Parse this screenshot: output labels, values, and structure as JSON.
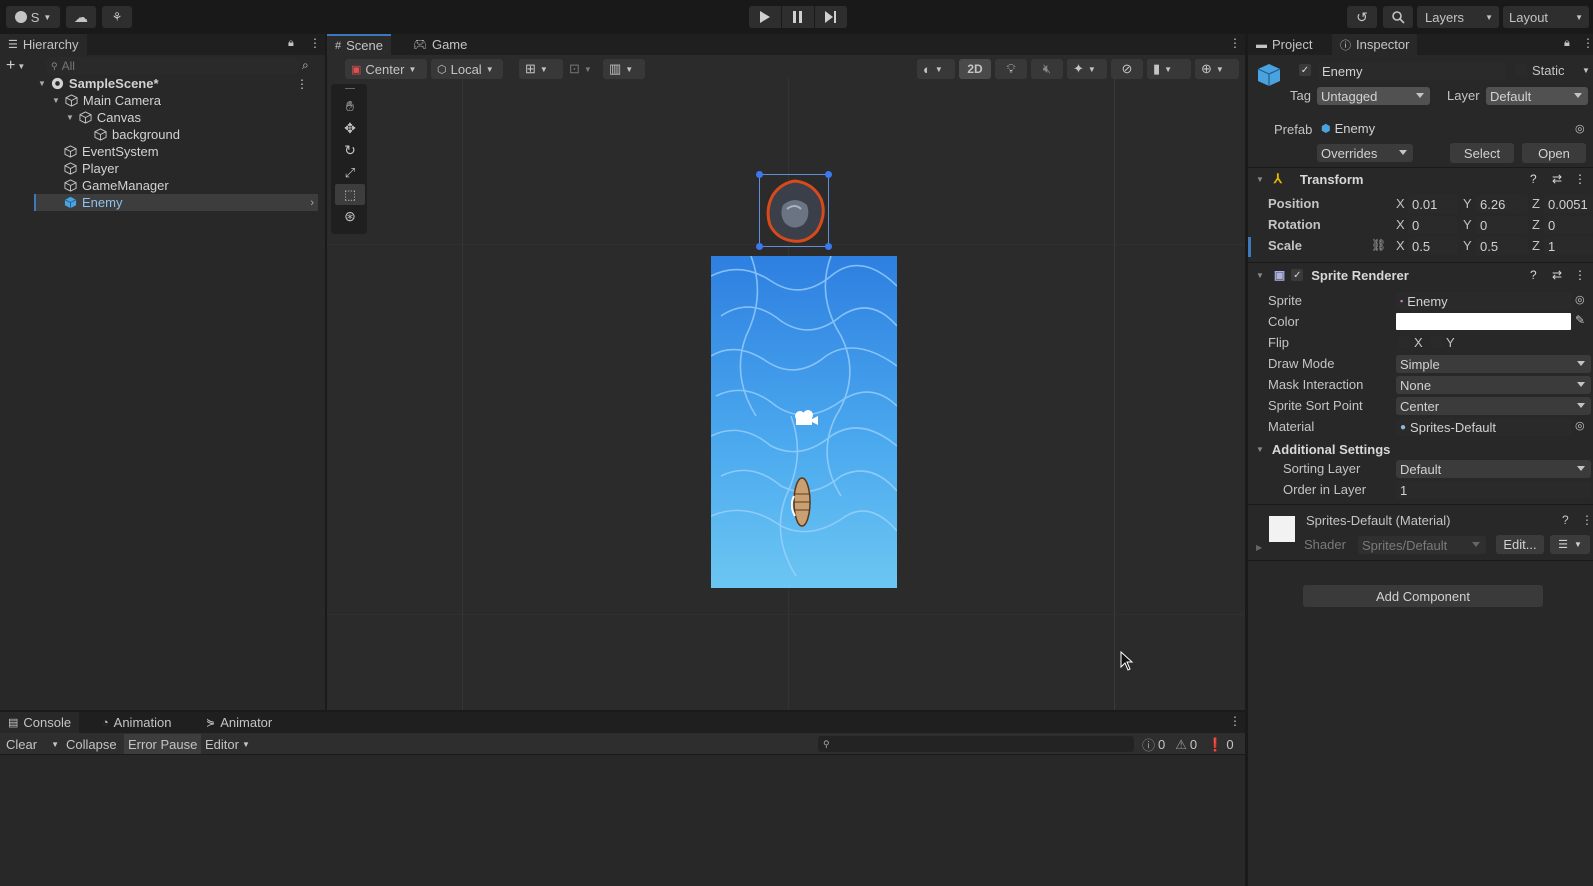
{
  "topbar": {
    "account_label": "S",
    "layers_label": "Layers",
    "layout_label": "Layout"
  },
  "hierarchy": {
    "tab_label": "Hierarchy",
    "search_placeholder": "All",
    "scene_name": "SampleScene*",
    "items": [
      {
        "label": "Main Camera"
      },
      {
        "label": "Canvas"
      },
      {
        "label": "background"
      },
      {
        "label": "EventSystem"
      },
      {
        "label": "Player"
      },
      {
        "label": "GameManager"
      },
      {
        "label": "Enemy"
      }
    ]
  },
  "scene": {
    "tabs": [
      {
        "label": "Scene"
      },
      {
        "label": "Game"
      }
    ],
    "pivot_label": "Center",
    "space_label": "Local",
    "mode_2d_label": "2D"
  },
  "bottom": {
    "tabs": [
      {
        "label": "Console"
      },
      {
        "label": "Animation"
      },
      {
        "label": "Animator"
      }
    ],
    "clear_label": "Clear",
    "collapse_label": "Collapse",
    "error_pause_label": "Error Pause",
    "editor_label": "Editor",
    "log_count": "0",
    "warning_count": "0",
    "error_count": "0"
  },
  "inspector": {
    "tabs": [
      {
        "label": "Project"
      },
      {
        "label": "Inspector"
      }
    ],
    "object_name": "Enemy",
    "static_label": "Static",
    "tag_label": "Tag",
    "tag_value": "Untagged",
    "layer_label": "Layer",
    "layer_value": "Default",
    "prefab_label": "Prefab",
    "prefab_value": "Enemy",
    "overrides_label": "Overrides",
    "select_label": "Select",
    "open_label": "Open",
    "transform": {
      "title": "Transform",
      "position_label": "Position",
      "rotation_label": "Rotation",
      "scale_label": "Scale",
      "position": {
        "x": "0.01",
        "y": "6.26",
        "z": "0.0051"
      },
      "rotation": {
        "x": "0",
        "y": "0",
        "z": "0"
      },
      "scale": {
        "x": "0.5",
        "y": "0.5",
        "z": "1"
      }
    },
    "sprite_renderer": {
      "title": "Sprite Renderer",
      "sprite_label": "Sprite",
      "sprite_value": "Enemy",
      "color_label": "Color",
      "flip_label": "Flip",
      "flip_x": "X",
      "flip_y": "Y",
      "draw_mode_label": "Draw Mode",
      "draw_mode_value": "Simple",
      "mask_label": "Mask Interaction",
      "mask_value": "None",
      "sort_point_label": "Sprite Sort Point",
      "sort_point_value": "Center",
      "material_label": "Material",
      "material_value": "Sprites-Default",
      "additional_title": "Additional Settings",
      "sorting_layer_label": "Sorting Layer",
      "sorting_layer_value": "Default",
      "order_label": "Order in Layer",
      "order_value": "1"
    },
    "material": {
      "title": "Sprites-Default (Material)",
      "shader_label": "Shader",
      "shader_value": "Sprites/Default",
      "edit_label": "Edit..."
    },
    "add_component_label": "Add Component"
  },
  "colors": {
    "accent": "#3a79bb",
    "selection": "#2c5d87",
    "water_top": "#2e7fe0",
    "water_bottom": "#6cc6f2"
  }
}
